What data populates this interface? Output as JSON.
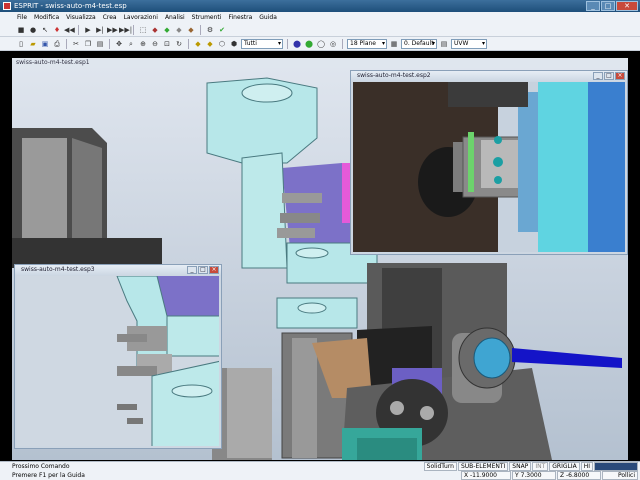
{
  "window": {
    "title": "ESPRIT - swiss-auto-m4-test.esp"
  },
  "menu": [
    "File",
    "Modifica",
    "Visualizza",
    "Crea",
    "Lavorazioni",
    "Analisi",
    "Strumenti",
    "Finestra",
    "Guida"
  ],
  "toolbar2": {
    "filter_value": "Tutti",
    "plane_value": "18 Plane",
    "layer_value": "0. Default",
    "coord_value": "UVW"
  },
  "mdi_main": {
    "title": "swiss-auto-m4-test.esp1"
  },
  "window2": {
    "title": "swiss-auto-m4-test.esp2"
  },
  "window3": {
    "title": "swiss-auto-m4-test.esp3"
  },
  "status": {
    "prompt": "Prossimo Comando",
    "hint": "Premere F1 per la Guida",
    "mode": "SolidTurn",
    "sub_elements": "SUB-ELEMENTI",
    "snap": "SNAP",
    "int": "INT",
    "grid": "GRIGLIA",
    "hi": "HI",
    "x": "X -11.9000",
    "y": "Y 7.3000",
    "z": "Z -6.8000",
    "units": "Pollici"
  }
}
